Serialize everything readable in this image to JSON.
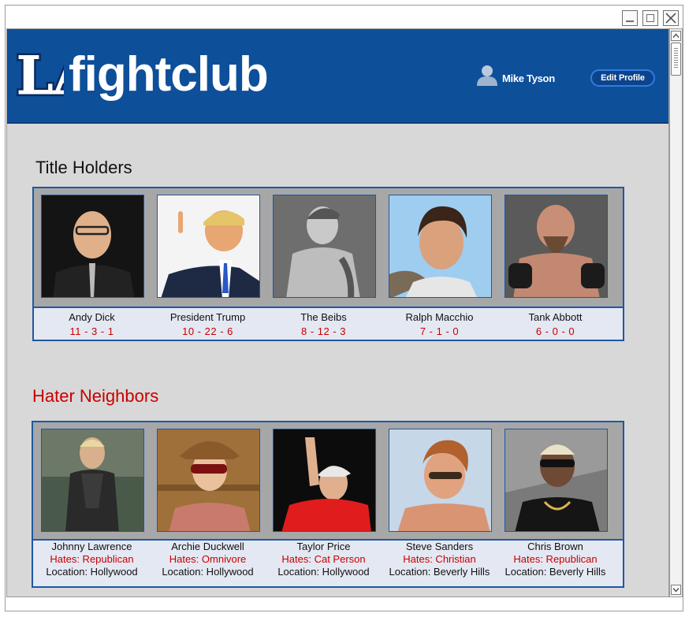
{
  "app": {
    "brand": "fightclub",
    "logo_text": "LA"
  },
  "header": {
    "user_name": "Mike Tyson",
    "edit_profile_label": "Edit Profile"
  },
  "title_holders": {
    "heading": "Title Holders",
    "items": [
      {
        "name": "Andy Dick",
        "record": "11 - 3 - 1"
      },
      {
        "name": "President Trump",
        "record": "10 - 22 - 6"
      },
      {
        "name": "The Beibs",
        "record": "8 - 12 - 3"
      },
      {
        "name": "Ralph Macchio",
        "record": "7 - 1 - 0"
      },
      {
        "name": "Tank Abbott",
        "record": "6 - 0 - 0"
      }
    ]
  },
  "hater_neighbors": {
    "heading": "Hater Neighbors",
    "items": [
      {
        "name": "Johnny Lawrence",
        "hates": "Hates: Republican",
        "location": "Location: Hollywood"
      },
      {
        "name": "Archie Duckwell",
        "hates": "Hates: Omnivore",
        "location": "Location: Hollywood"
      },
      {
        "name": "Taylor Price",
        "hates": "Hates: Cat Person",
        "location": "Location: Hollywood"
      },
      {
        "name": "Steve Sanders",
        "hates": "Hates: Christian",
        "location": "Location: Beverly Hills"
      },
      {
        "name": "Chris Brown",
        "hates": "Hates: Republican",
        "location": "Location: Beverly Hills"
      }
    ]
  },
  "colors": {
    "header_blue": "#0e4f9a",
    "accent_red": "#c80000",
    "panel_border": "#1f58a0"
  },
  "icons": [
    "minimize-icon",
    "maximize-icon",
    "close-icon",
    "user-icon",
    "scroll-up-icon",
    "scroll-down-icon"
  ]
}
